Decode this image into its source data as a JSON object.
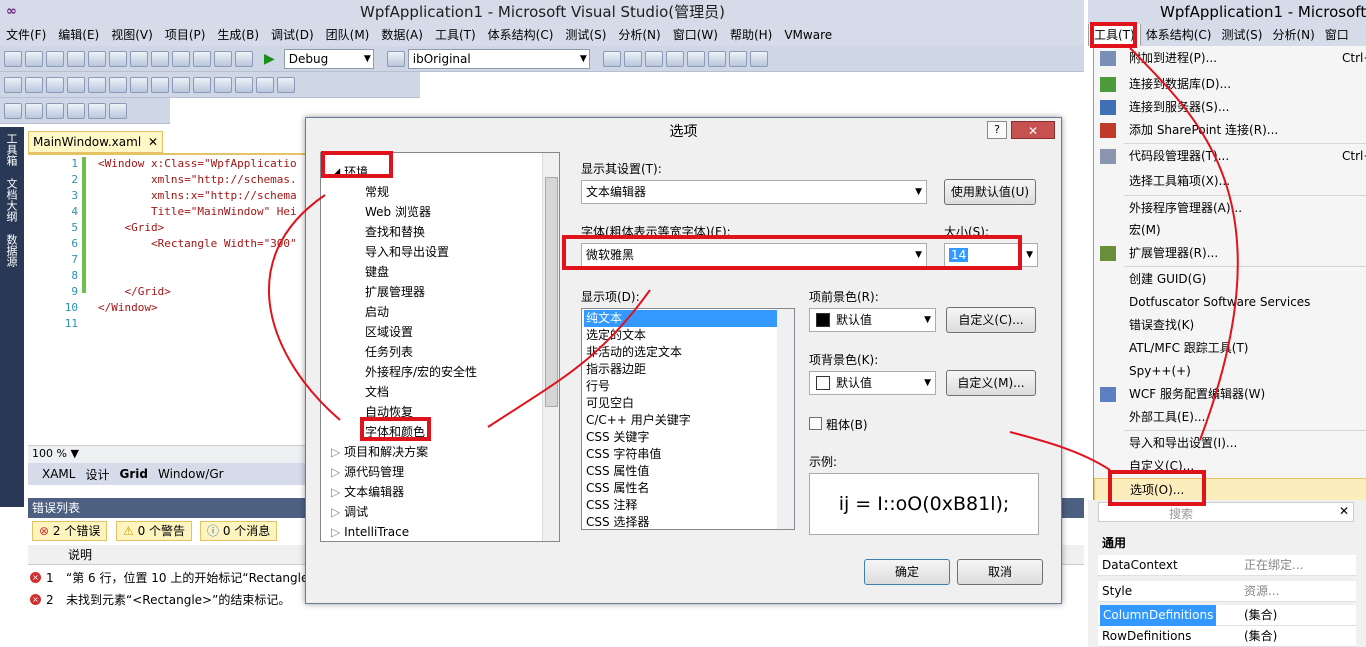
{
  "window": {
    "title": "WpfApplication1 - Microsoft Visual Studio(管理员)",
    "logo": "∞"
  },
  "menu": [
    "文件(F)",
    "编辑(E)",
    "视图(V)",
    "项目(P)",
    "生成(B)",
    "调试(D)",
    "团队(M)",
    "数据(A)",
    "工具(T)",
    "体系结构(C)",
    "测试(S)",
    "分析(N)",
    "窗口(W)",
    "帮助(H)",
    "VMware"
  ],
  "toolbar": {
    "config": "Debug",
    "target": "ibOriginal"
  },
  "side_tabs": [
    "工具箱",
    "文档大纲",
    "数据源"
  ],
  "editor": {
    "tab_label": "MainWindow.xaml",
    "line_numbers": [
      "1",
      "2",
      "3",
      "4",
      "5",
      "6",
      "7",
      "8",
      "9",
      "10",
      "11"
    ],
    "code_lines": [
      "<Window x:Class=\"WpfApplicatio",
      "        xmlns=\"http://schemas.",
      "        xmlns:x=\"http://schema",
      "        Title=\"MainWindow\" Hei",
      "    <Grid>",
      "        <Rectangle Width=\"300\"",
      "",
      "",
      "    </Grid>",
      "</Window>",
      ""
    ],
    "zoom": "100 %",
    "view_tabs": [
      "XAML",
      "设计",
      "Grid",
      "Window/Gr"
    ]
  },
  "error_list": {
    "title": "错误列表",
    "errors_btn": "2 个错误",
    "warnings_btn": "0 个警告",
    "messages_btn": "0 个消息",
    "col_header": "说明",
    "rows": [
      {
        "num": "1",
        "text": "“第 6 行，位置 10 上的开始标记“Rectangle”"
      },
      {
        "num": "2",
        "text": "未找到元素“<Rectangle>”的结束标记。"
      }
    ]
  },
  "dialog": {
    "title": "选项",
    "help": "?",
    "close": "✕",
    "tree": {
      "root": "环境",
      "children": [
        "常规",
        "Web 浏览器",
        "查找和替换",
        "导入和导出设置",
        "键盘",
        "扩展管理器",
        "启动",
        "区域设置",
        "任务列表",
        "外接程序/宏的安全性",
        "文档",
        "自动恢复",
        "字体和颜色"
      ],
      "siblings": [
        "项目和解决方案",
        "源代码管理",
        "文本编辑器",
        "调试",
        "IntelliTrace"
      ]
    },
    "show_settings_label": "显示其设置(T):",
    "show_settings_value": "文本编辑器",
    "use_defaults_btn": "使用默认值(U)",
    "font_label": "字体(粗体表示等宽字体)(F):",
    "font_value": "微软雅黑",
    "size_label": "大小(S):",
    "size_value": "14",
    "display_items_label": "显示项(D):",
    "display_items": [
      "纯文本",
      "选定的文本",
      "非活动的选定文本",
      "指示器边距",
      "行号",
      "可见空白",
      "C/C++ 用户关键字",
      "CSS 关键字",
      "CSS 字符串值",
      "CSS 属性值",
      "CSS 属性名",
      "CSS 注释",
      "CSS 选择器"
    ],
    "fg_label": "项前景色(R):",
    "fg_value": "默认值",
    "bg_label": "项背景色(K):",
    "bg_value": "默认值",
    "custom_btn_fg": "自定义(C)...",
    "custom_btn_bg": "自定义(M)...",
    "bold_label": "粗体(B)",
    "sample_label": "示例:",
    "sample_text": "ij = I::oO(0xB81l);",
    "ok_btn": "确定",
    "cancel_btn": "取消"
  },
  "right": {
    "title": "WpfApplication1 - Microsoft",
    "menu": [
      "工具(T)",
      "体系结构(C)",
      "测试(S)",
      "分析(N)",
      "窗口"
    ],
    "dropdown": [
      {
        "label": "附加到进程(P)...",
        "shortcut": "Ctrl+"
      },
      {
        "label": "连接到数据库(D)...",
        "shortcut": ""
      },
      {
        "label": "连接到服务器(S)...",
        "shortcut": ""
      },
      {
        "label": "添加 SharePoint 连接(R)...",
        "shortcut": ""
      },
      {
        "label": "代码段管理器(T)...",
        "shortcut": "Ctrl+"
      },
      {
        "label": "选择工具箱项(X)...",
        "shortcut": ""
      },
      {
        "label": "外接程序管理器(A)...",
        "shortcut": ""
      },
      {
        "label": "宏(M)",
        "shortcut": ""
      },
      {
        "label": "扩展管理器(R)...",
        "shortcut": ""
      },
      {
        "label": "创建 GUID(G)",
        "shortcut": ""
      },
      {
        "label": "Dotfuscator Software Services",
        "shortcut": ""
      },
      {
        "label": "错误查找(K)",
        "shortcut": ""
      },
      {
        "label": "ATL/MFC 跟踪工具(T)",
        "shortcut": ""
      },
      {
        "label": "Spy++(+)",
        "shortcut": ""
      },
      {
        "label": "WCF 服务配置编辑器(W)",
        "shortcut": ""
      },
      {
        "label": "外部工具(E)...",
        "shortcut": ""
      },
      {
        "label": "导入和导出设置(I)...",
        "shortcut": ""
      },
      {
        "label": "自定义(C)...",
        "shortcut": ""
      },
      {
        "label": "选项(O)...",
        "shortcut": ""
      }
    ],
    "search_placeholder": "搜索",
    "props_section": "通用",
    "props": [
      {
        "key": "DataContext",
        "value": "正在绑定..."
      },
      {
        "key": "Style",
        "value": "资源..."
      },
      {
        "key": "ColumnDefinitions",
        "value": "(集合)"
      },
      {
        "key": "RowDefinitions",
        "value": "(集合)"
      }
    ]
  },
  "colors": {
    "annotation": "#e0121c",
    "vs_chrome": "#d6dbe9",
    "selection": "#3399ff"
  }
}
